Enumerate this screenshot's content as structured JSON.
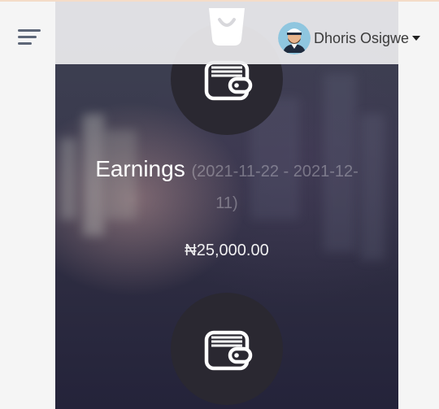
{
  "header": {
    "user_name": "Dhoris Osigwe"
  },
  "earnings_card": {
    "title": "Earnings",
    "date_range": "(2021-11-22 - 2021-12-11)",
    "amount": "₦25,000.00"
  },
  "icons": {
    "menu": "hamburger-menu-icon",
    "logo": "shopping-bag-icon",
    "avatar": "user-avatar",
    "caret": "caret-down-icon",
    "wallet": "wallet-icon"
  },
  "colors": {
    "card_circle": "#2a2831",
    "header_bg": "#ececee",
    "menu_icon": "#5d6677"
  }
}
